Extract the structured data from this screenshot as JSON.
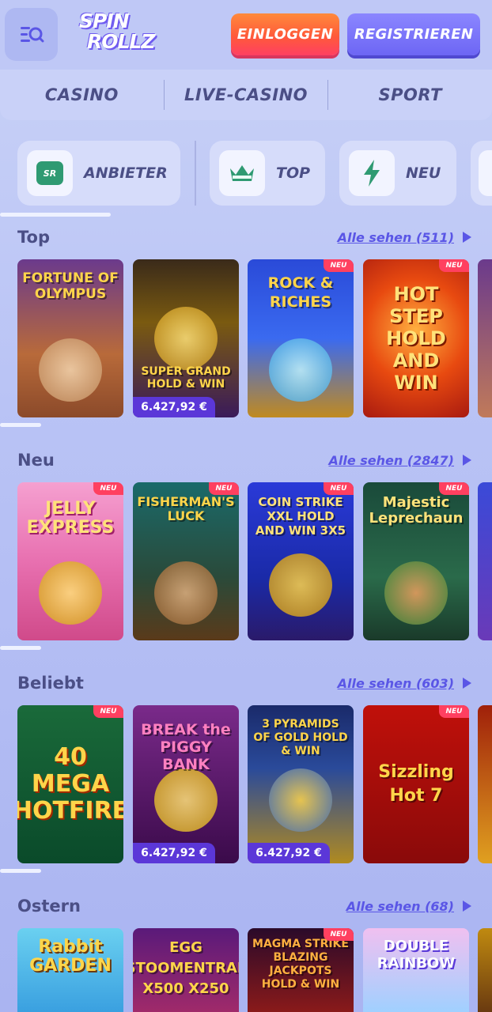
{
  "header": {
    "logo_line1": "SPIN",
    "logo_line2": "ROLLZ",
    "login_label": "EINLOGGEN",
    "register_label": "REGISTRIEREN"
  },
  "nav": {
    "items": [
      "CASINO",
      "LIVE-CASINO",
      "SPORT"
    ]
  },
  "chips": [
    {
      "label": "ANBIETER",
      "icon": "sr-provider-icon",
      "icon_text": "SR"
    },
    {
      "label": "TOP",
      "icon": "crown-icon"
    },
    {
      "label": "NEU",
      "icon": "lightning-icon"
    }
  ],
  "sections": [
    {
      "title": "Top",
      "see_all": "Alle sehen (511)",
      "tiles": [
        {
          "name": "FORTUNE OF OLYMPUS",
          "neu": false,
          "jackpot": ""
        },
        {
          "name": "SUPER GRAND HOLD & WIN",
          "neu": false,
          "jackpot": "6.427,92 €"
        },
        {
          "name": "ROCK & RICHES",
          "neu": true,
          "jackpot": ""
        },
        {
          "name": "HOT STEP HOLD AND WIN",
          "neu": true,
          "jackpot": ""
        }
      ]
    },
    {
      "title": "Neu",
      "see_all": "Alle sehen (2847)",
      "tiles": [
        {
          "name": "JELLY EXPRESS",
          "neu": true,
          "jackpot": ""
        },
        {
          "name": "FISHERMAN'S LUCK",
          "neu": true,
          "jackpot": ""
        },
        {
          "name": "COIN STRIKE XXL HOLD AND WIN 3X5",
          "neu": true,
          "jackpot": ""
        },
        {
          "name": "Majestic Leprechaun",
          "neu": true,
          "jackpot": ""
        }
      ]
    },
    {
      "title": "Beliebt",
      "see_all": "Alle sehen (603)",
      "tiles": [
        {
          "name": "40 MEGA HOTFIRE",
          "neu": true,
          "jackpot": ""
        },
        {
          "name": "BREAK the PIGGY BANK",
          "neu": false,
          "jackpot": "6.427,92 €"
        },
        {
          "name": "3 PYRAMIDS OF GOLD HOLD & WIN",
          "neu": false,
          "jackpot": "6.427,92 €"
        },
        {
          "name": "Sizzling Hot 7",
          "neu": true,
          "jackpot": ""
        }
      ]
    },
    {
      "title": "Ostern",
      "see_all": "Alle sehen (68)",
      "tiles": [
        {
          "name": "Rabbit GARDEN",
          "neu": false,
          "jackpot": ""
        },
        {
          "name": "EGG STOOMENTRAL X500 X250",
          "neu": false,
          "jackpot": ""
        },
        {
          "name": "MAGMA STRIKE BLAZING JACKPOTS HOLD & WIN",
          "neu": true,
          "jackpot": ""
        },
        {
          "name": "DOUBLE RAINBOW",
          "neu": false,
          "jackpot": ""
        }
      ]
    }
  ],
  "badge_neu": "NEU",
  "colors": {
    "accent": "#5a56e6",
    "login_gradient": "#ff5a3a",
    "register_gradient": "#6d66f4",
    "badge": "#ff4060"
  }
}
